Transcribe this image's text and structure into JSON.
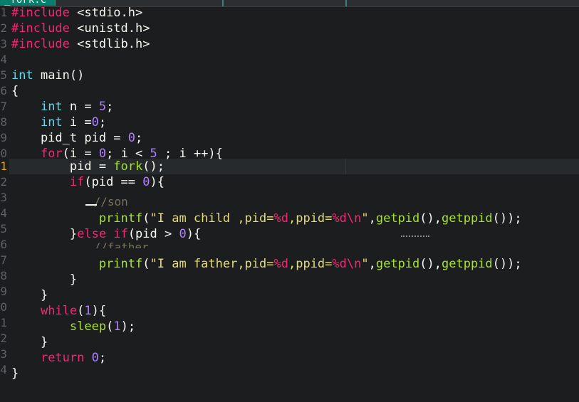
{
  "tab": {
    "title": "_fork.c"
  },
  "editor": {
    "active_line": 11,
    "line_numbers": [
      "1",
      "2",
      "3",
      "4",
      "5",
      "6",
      "7",
      "8",
      "9",
      "0",
      "1",
      "2",
      "3",
      "4",
      "5",
      "6",
      "7",
      "8",
      "9",
      "0",
      "1",
      "2",
      "3",
      "4"
    ],
    "lines": [
      [
        "#include",
        " <stdio.h>"
      ],
      [
        "#include",
        " <unistd.h>"
      ],
      [
        "#include",
        " <stdlib.h>"
      ],
      [],
      [
        "int",
        " main()"
      ],
      [
        "{"
      ],
      [
        "    ",
        "int",
        " n = ",
        "5",
        ";"
      ],
      [
        "    ",
        "int",
        " i =",
        "0",
        ";"
      ],
      [
        "    pid_t pid = ",
        "0",
        ";"
      ],
      [
        "    ",
        "for",
        "(i = ",
        "0",
        "; i < ",
        "5",
        " ; i ++){"
      ],
      [
        "        pid = ",
        "fork",
        "();"
      ],
      [
        "        ",
        "if",
        "(pid == ",
        "0",
        "){"
      ],
      [
        "            ",
        "//son"
      ],
      [
        "            ",
        "printf",
        "(",
        "\"I am child ,pid=",
        "%d",
        ",ppid=",
        "%d\\n",
        "\"",
        ",",
        "getpid",
        "(),",
        "getppid",
        "());"
      ],
      [
        "        }",
        "else",
        " ",
        "if",
        "(pid > ",
        "0",
        "){"
      ],
      [
        "            ",
        "//father"
      ],
      [
        "            ",
        "printf",
        "(",
        "\"I am father,pid=",
        "%d",
        ",ppid=",
        "%d\\n",
        "\"",
        ",",
        "getpid",
        "(),",
        "getppid",
        "());"
      ],
      [
        "        }"
      ],
      [
        "    }"
      ],
      [
        "    ",
        "while",
        "(",
        "1",
        "){"
      ],
      [
        "        ",
        "sleep",
        "(",
        "1",
        ");"
      ],
      [
        "    }"
      ],
      [
        "    ",
        "return",
        " ",
        "0",
        ";"
      ],
      [
        "}"
      ]
    ]
  },
  "theme": {
    "background": "#1b1d1e",
    "tab_accent": "#06806c",
    "preprocessor": "#f92672",
    "type_keyword": "#66d9ef",
    "control_keyword": "#f92672",
    "number": "#ae81ff",
    "function": "#a6e22e",
    "string": "#e6db74",
    "comment": "#75715e",
    "active_line_number": "#f0a400"
  }
}
